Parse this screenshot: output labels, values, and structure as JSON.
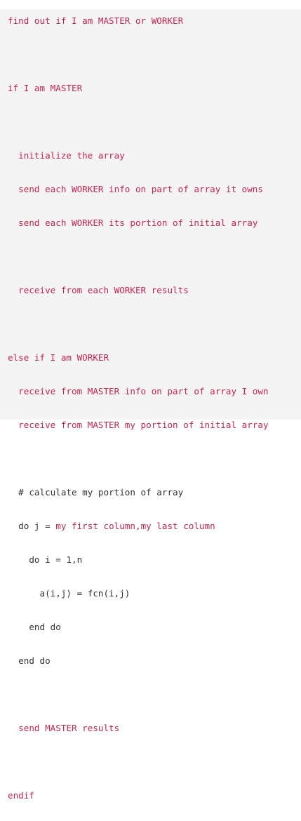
{
  "code": {
    "lines": [
      {
        "text": "find out if I am MASTER or WORKER",
        "tone": "red"
      },
      {
        "text": "",
        "tone": "red"
      },
      {
        "text": "if I am MASTER",
        "tone": "red"
      },
      {
        "text": "",
        "tone": "red"
      },
      {
        "text": "  initialize the array",
        "tone": "red"
      },
      {
        "text": "  send each WORKER info on part of array it owns",
        "tone": "red"
      },
      {
        "text": "  send each WORKER its portion of initial array",
        "tone": "red"
      },
      {
        "text": "",
        "tone": "red"
      },
      {
        "text": "  receive from each WORKER results",
        "tone": "red"
      },
      {
        "text": "",
        "tone": "red"
      },
      {
        "text": "else if I am WORKER",
        "tone": "red"
      },
      {
        "text": "  receive from MASTER info on part of array I own",
        "tone": "red"
      },
      {
        "text": "  receive from MASTER my portion of initial array",
        "tone": "red"
      },
      {
        "text": "",
        "tone": "red"
      },
      {
        "text": "  # calculate my portion of array",
        "tone": "dark"
      },
      {
        "parts": [
          {
            "text": "  do j = ",
            "tone": "dark"
          },
          {
            "text": "my first column,my last column",
            "tone": "red"
          }
        ]
      },
      {
        "text": "    do i = 1,n",
        "tone": "dark"
      },
      {
        "text": "      a(i,j) = fcn(i,j)",
        "tone": "dark"
      },
      {
        "text": "    end do",
        "tone": "dark"
      },
      {
        "text": "  end do",
        "tone": "dark"
      },
      {
        "text": "",
        "tone": "red"
      },
      {
        "text": "  send MASTER results",
        "tone": "red"
      },
      {
        "text": "",
        "tone": "red"
      },
      {
        "text": "endif",
        "tone": "red"
      }
    ]
  },
  "colors": {
    "red": "#c7254e",
    "dark": "#333333",
    "background": "#f4f4f4"
  }
}
